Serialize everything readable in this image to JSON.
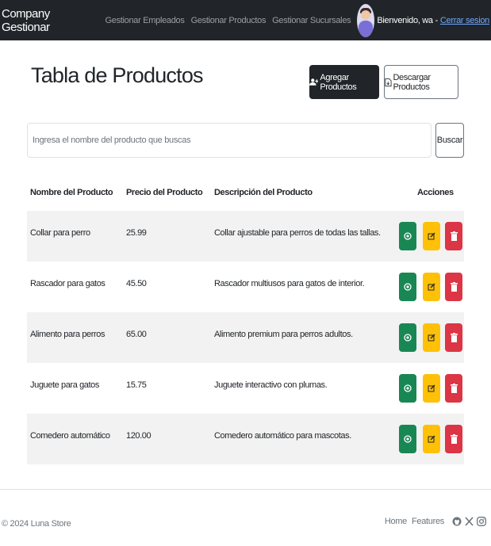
{
  "navbar": {
    "brand": "Company Gestionar",
    "links": [
      "Gestionar Empleados",
      "Gestionar Productos",
      "Gestionar Sucursales"
    ],
    "welcome": "Bienvenido, wa -",
    "logout": "Cerrar sesion"
  },
  "page": {
    "title": "Tabla de Productos",
    "add_button": "Agregar Productos",
    "download_button": "Descargar Productos"
  },
  "search": {
    "placeholder": "Ingresa el nombre del producto que buscas",
    "value": "",
    "button": "Buscar"
  },
  "table": {
    "headers": [
      "Nombre del Producto",
      "Precio del Producto",
      "Descripción del Producto",
      "Acciones"
    ],
    "rows": [
      {
        "name": "Collar para perro",
        "price": "25.99",
        "description": "Collar ajustable para perros de todas las tallas."
      },
      {
        "name": "Rascador para gatos",
        "price": "45.50",
        "description": "Rascador multiusos para gatos de interior."
      },
      {
        "name": "Alimento para perros",
        "price": "65.00",
        "description": "Alimento premium para perros adultos."
      },
      {
        "name": "Juguete para gatos",
        "price": "15.75",
        "description": "Juguete interactivo con plumas."
      },
      {
        "name": "Comedero automático",
        "price": "120.00",
        "description": "Comedero automático para mascotas."
      }
    ],
    "action_icons": [
      "eye-icon",
      "edit-icon",
      "trash-icon"
    ]
  },
  "footer": {
    "copyright": "© 2024 Luna Store",
    "links": [
      "Home",
      "Features"
    ],
    "social_icons": [
      "github-icon",
      "x-icon",
      "instagram-icon"
    ]
  },
  "colors": {
    "navbar": "#212529",
    "view": "#198754",
    "edit": "#ffc107",
    "delete": "#dc3545",
    "stripe": "#f2f2f2"
  }
}
